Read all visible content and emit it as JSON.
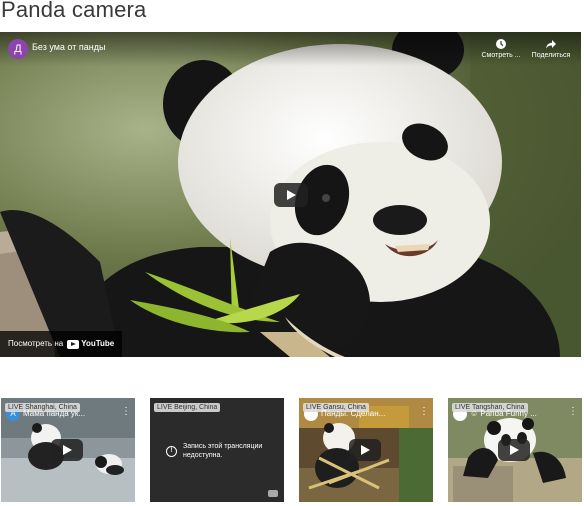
{
  "page": {
    "title": "Panda camera"
  },
  "main_player": {
    "avatar_letter": "Д",
    "channel_title": "Без ума от панды",
    "watch_later_label": "Смотреть ...",
    "share_label": "Поделиться",
    "watch_on_label": "Посмотреть на",
    "youtube_label": "YouTube",
    "avatar_color": "#8e44ad"
  },
  "thumbnails": [
    {
      "live_badge": "LIVE Shanghai, China",
      "title": "Мама панда ук...",
      "avatar_letter": "А"
    },
    {
      "live_badge": "LIVE Beijing, China",
      "message": "Запись этой трансляции недоступна."
    },
    {
      "live_badge": "LIVE Gansu, China",
      "title": "Панды. Сделан...",
      "avatar_letter": ""
    },
    {
      "live_badge": "LIVE Tangshan, China",
      "title": "☺ Panda Funny ...",
      "avatar_letter": ""
    }
  ]
}
